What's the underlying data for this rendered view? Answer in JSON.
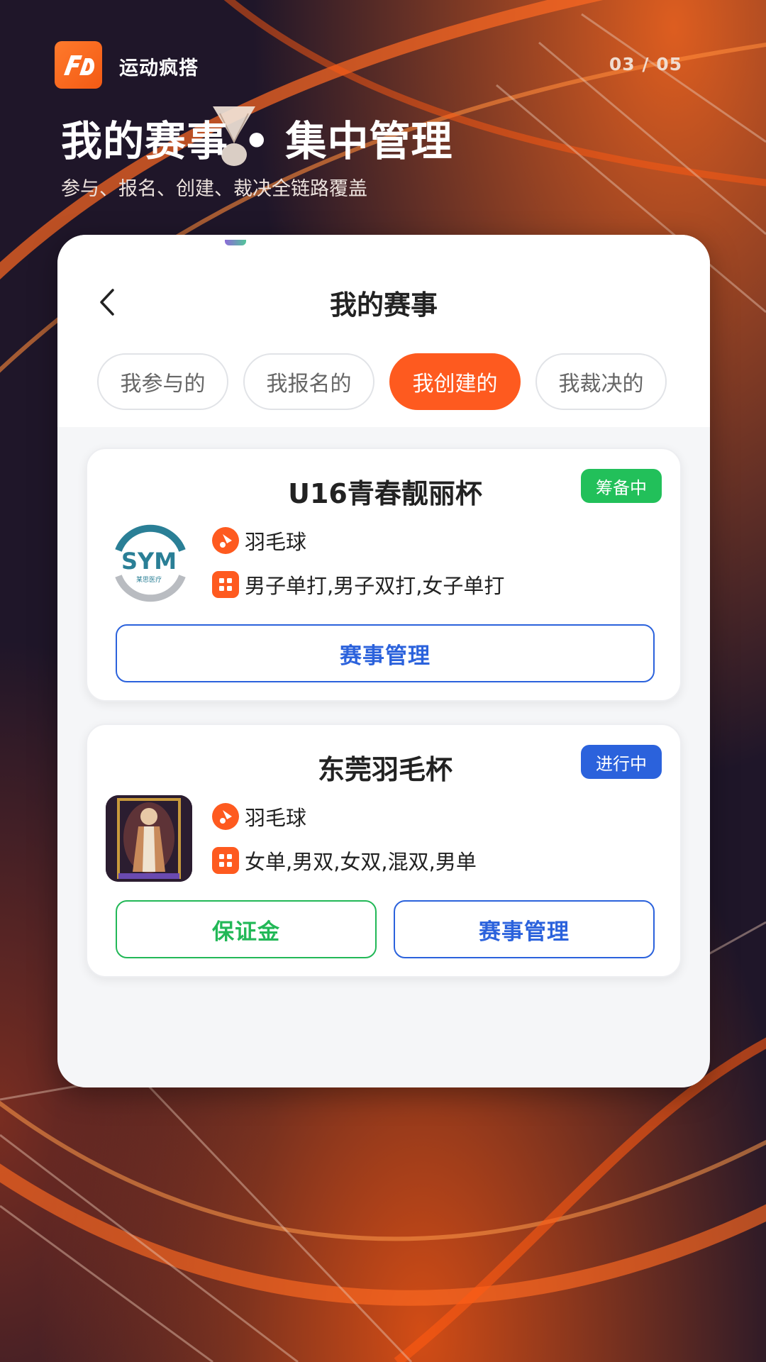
{
  "header": {
    "brand": "运动疯搭",
    "page_counter": "03 / 05",
    "headline": "我的赛事 • 集中管理",
    "subline": "参与、报名、创建、裁决全链路覆盖"
  },
  "screen": {
    "title": "我的赛事",
    "tabs": [
      {
        "label": "我参与的",
        "active": false
      },
      {
        "label": "我报名的",
        "active": false
      },
      {
        "label": "我创建的",
        "active": true
      },
      {
        "label": "我裁决的",
        "active": false
      }
    ]
  },
  "events": [
    {
      "title": "U16青春靓丽杯",
      "status": "筹备中",
      "status_color": "#22c05a",
      "sport": "羽毛球",
      "categories": "男子单打,男子双打,女子单打",
      "thumb": {
        "logo_text": "SYM",
        "caption": "某思医疗"
      },
      "manage_label": "赛事管理"
    },
    {
      "title": "东莞羽毛杯",
      "status": "进行中",
      "status_color": "#2b62dc",
      "sport": "羽毛球",
      "categories": "女单,男双,女双,混双,男单",
      "deposit_label": "保证金",
      "manage_label": "赛事管理"
    }
  ],
  "colors": {
    "accent": "#fe5a1f",
    "blue": "#2b62dc",
    "green": "#22b857"
  },
  "icons": [
    "back-arrow-icon",
    "shuttlecock-icon",
    "grid-icon",
    "brand-logo-icon"
  ]
}
